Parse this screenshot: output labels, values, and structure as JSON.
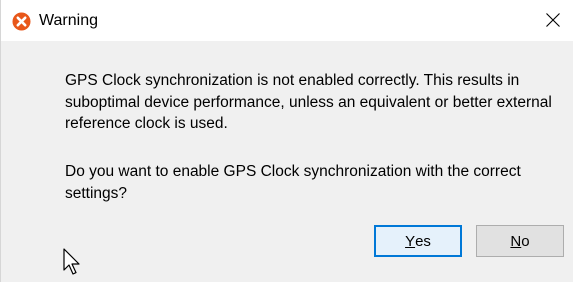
{
  "window": {
    "title": "Warning",
    "close_glyph": "✕",
    "icon": "error-icon",
    "icon_color": "#e8571a"
  },
  "messages": {
    "line1": "GPS Clock synchronization is not enabled correctly. This results in suboptimal device performance, unless an equivalent or better external reference clock is used.",
    "line2": "Do you want to enable GPS Clock synchronization with the correct settings?"
  },
  "buttons": {
    "yes": {
      "mnemonic": "Y",
      "rest": "es"
    },
    "no": {
      "mnemonic": "N",
      "rest": "o"
    }
  },
  "colors": {
    "accent": "#0078d7",
    "dialog_bg": "#f0f0f0"
  }
}
